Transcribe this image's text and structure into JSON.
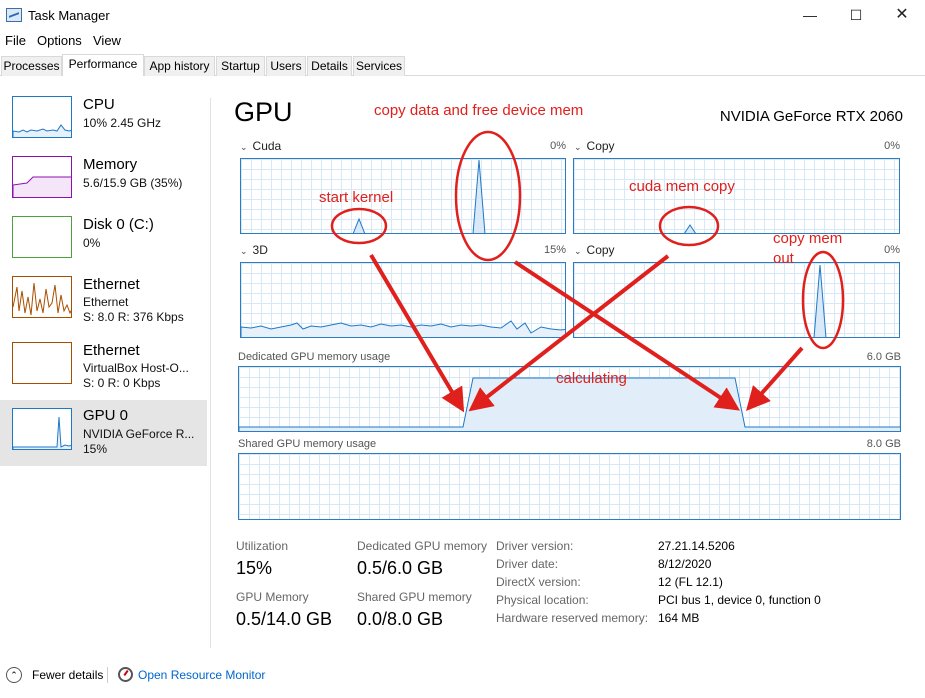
{
  "window": {
    "title": "Task Manager",
    "minimize_icon": "minimize-icon",
    "maximize_icon": "maximize-icon",
    "close_icon": "close-icon"
  },
  "menu": [
    "File",
    "Options",
    "View"
  ],
  "tabs": [
    {
      "label": "Processes",
      "active": false
    },
    {
      "label": "Performance",
      "active": true
    },
    {
      "label": "App history",
      "active": false
    },
    {
      "label": "Startup",
      "active": false
    },
    {
      "label": "Users",
      "active": false
    },
    {
      "label": "Details",
      "active": false
    },
    {
      "label": "Services",
      "active": false
    }
  ],
  "sidebar": [
    {
      "title": "CPU",
      "sub": "10% 2.45 GHz",
      "sub2": "",
      "color": "#1e78c8"
    },
    {
      "title": "Memory",
      "sub": "5.6/15.9 GB (35%)",
      "sub2": "",
      "color": "#8b12ae"
    },
    {
      "title": "Disk 0 (C:)",
      "sub": "0%",
      "sub2": "",
      "color": "#4da33b"
    },
    {
      "title": "Ethernet",
      "sub": "Ethernet",
      "sub2": "S: 8.0  R: 376 Kbps",
      "color": "#a74f01"
    },
    {
      "title": "Ethernet",
      "sub": "VirtualBox Host-O...",
      "sub2": "S: 0  R: 0 Kbps",
      "color": "#a74f01"
    },
    {
      "title": "GPU 0",
      "sub": "NVIDIA GeForce R...",
      "sub2": "15%",
      "color": "#1e78c8",
      "selected": true
    }
  ],
  "main": {
    "heading": "GPU",
    "model": "NVIDIA GeForce RTX 2060",
    "engines": [
      {
        "name": "Cuda",
        "pct": "0%"
      },
      {
        "name": "Copy",
        "pct": "0%"
      },
      {
        "name": "3D",
        "pct": "15%"
      },
      {
        "name": "Copy",
        "pct": "0%"
      }
    ],
    "dedicated_label": "Dedicated GPU memory usage",
    "dedicated_max": "6.0 GB",
    "shared_label": "Shared GPU memory usage",
    "shared_max": "8.0 GB"
  },
  "stats": {
    "utilization_label": "Utilization",
    "utilization_value": "15%",
    "dedicated_label": "Dedicated GPU memory",
    "dedicated_value": "0.5/6.0 GB",
    "gpu_memory_label": "GPU Memory",
    "gpu_memory_value": "0.5/14.0 GB",
    "shared_label": "Shared GPU memory",
    "shared_value": "0.0/8.0 GB"
  },
  "info": [
    {
      "label": "Driver version:",
      "value": "27.21.14.5206"
    },
    {
      "label": "Driver date:",
      "value": "8/12/2020"
    },
    {
      "label": "DirectX version:",
      "value": "12 (FL 12.1)"
    },
    {
      "label": "Physical location:",
      "value": "PCI bus 1, device 0, function 0"
    },
    {
      "label": "Hardware reserved memory:",
      "value": "164 MB"
    }
  ],
  "footer": {
    "fewer_details": "Fewer details",
    "open_monitor": "Open Resource Monitor"
  },
  "annotations": {
    "copy_free": "copy data and free device mem",
    "start_kernel": "start kernel",
    "cuda_mem_copy": "cuda mem copy",
    "copy_mem_out_1": "copy mem",
    "copy_mem_out_2": "out",
    "calculating": "calculating",
    "color": "#e0201c"
  }
}
